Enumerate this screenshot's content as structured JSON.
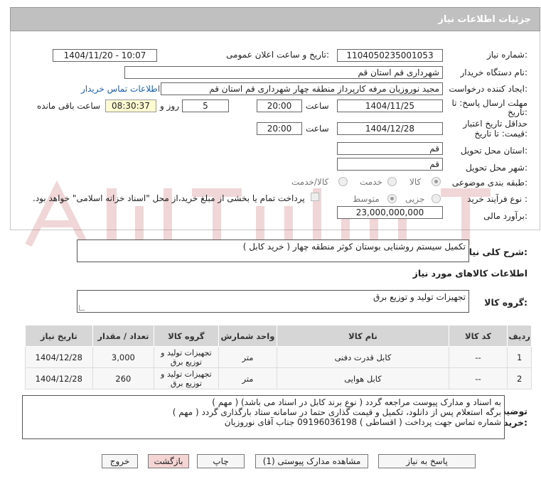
{
  "header": {
    "title": "جزئیات اطلاعات نیاز"
  },
  "fields": {
    "need_number_label": "شماره نیاز:",
    "need_number": "1104050235001053",
    "announce_label": "تاریخ و ساعت اعلان عمومی:",
    "announce_value": "1404/11/20 - 10:07",
    "buyer_org_label": "نام دستگاه خریدار:",
    "buyer_org": "شهرداری قم استان قم",
    "requester_label": "ایجاد کننده درخواست:",
    "requester": "مجید نوروزیان مرفه کارپرداز منطقه چهار شهرداری قم استان قم",
    "contact_link": "اطلاعات تماس خریدار",
    "deadline_label_1": "مهلت ارسال پاسخ: تا",
    "deadline_label_2": "تاریخ:",
    "deadline_date": "1404/11/25",
    "time_label": "ساعت",
    "deadline_time": "20:00",
    "days": "5",
    "days_label": "روز و",
    "remaining_time": "08:30:37",
    "remaining_label": "ساعت باقی مانده",
    "validity_label_1": "حداقل تاریخ اعتبار",
    "validity_label_2": "قیمت: تا تاریخ:",
    "validity_date": "1404/12/28",
    "validity_time_label": "ساعت",
    "validity_time": "20:00",
    "province_label": "استان محل تحویل:",
    "province": "قم",
    "city_label": "شهر محل تحویل:",
    "city": "قم",
    "category_label": "طبقه بندی موضوعی:",
    "category_options": [
      "کالا",
      "خدمت",
      "کالا/خدمت"
    ],
    "process_label": "نوع فرآیند خرید :",
    "process_options": [
      "جزیی",
      "متوسط"
    ],
    "payment_note": "پرداخت تمام یا بخشی از مبلغ خرید،از محل \"اسناد خزانه اسلامی\" خواهد بود.",
    "budget_label": "برآورد مالی:",
    "budget": "23,000,000,000"
  },
  "need_desc": {
    "label": "شرح کلی نیاز:",
    "value": "تکمیل سیستم روشنایی بوستان کوثر منطقه چهار ( خرید کابل )"
  },
  "goods_section": {
    "title": "اطلاعات کالاهای مورد نیاز",
    "group_label": "گروه کالا:",
    "group_value": "تجهیزات تولید و توزیع برق"
  },
  "table": {
    "headers": [
      "ردیف",
      "کد کالا",
      "نام کالا",
      "واحد شمارش",
      "گروه کالا",
      "تعداد / مقدار",
      "تاریخ نیاز"
    ],
    "rows": [
      [
        "1",
        "--",
        "کابل قدرت دفنی",
        "متر",
        "تجهیزات تولید و توزیع برق",
        "3,000",
        "1404/12/28"
      ],
      [
        "2",
        "--",
        "کابل هوایی",
        "متر",
        "تجهیزات تولید و توزیع برق",
        "260",
        "1404/12/28"
      ]
    ]
  },
  "buyer_notes": {
    "label_1": "توضیحات",
    "label_2": "خریدار:",
    "lines": [
      "به اسناد و مدارک پیوست مراجعه گردد ( نوع برند کابل در اسناد می باشد) ( مهم )",
      "برگه استعلام پس از دانلود، تکمیل و قیمت گذاری حتما در سامانه ستاد بارگذاری گردد ( مهم )",
      "شماره تماس جهت پرداخت ( اقساطی ) 09196036198 جناب آقای نوروزیان"
    ]
  },
  "buttons": {
    "reply": "پاسخ به نیاز",
    "attachments": "مشاهده مدارک پیوستی (1)",
    "print": "چاپ",
    "back": "بازگشت",
    "exit": "خروج"
  },
  "colors": {
    "header_bg": "#c0c0c0",
    "link": "#1a5fb4",
    "remaining_bg": "#fffbd0",
    "back_button": "#f5d4d4"
  }
}
